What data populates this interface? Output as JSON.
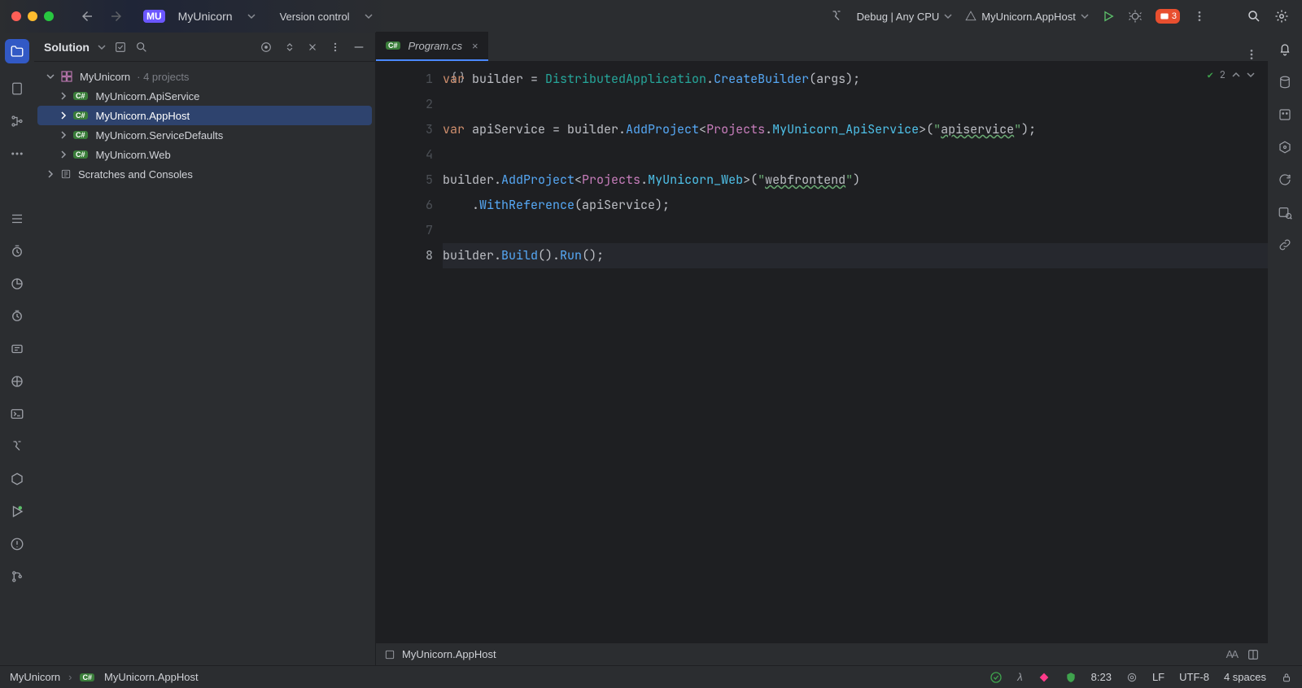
{
  "titlebar": {
    "project_badge": "MU",
    "project_name": "MyUnicorn",
    "version_control": "Version control",
    "run_config": "Debug | Any CPU",
    "target_project": "MyUnicorn.AppHost",
    "notification_count": "3"
  },
  "solution": {
    "title": "Solution",
    "root_name": "MyUnicorn",
    "project_count_label": "· 4 projects",
    "projects": [
      {
        "name": "MyUnicorn.ApiService",
        "selected": false
      },
      {
        "name": "MyUnicorn.AppHost",
        "selected": true
      },
      {
        "name": "MyUnicorn.ServiceDefaults",
        "selected": false
      },
      {
        "name": "MyUnicorn.Web",
        "selected": false
      }
    ],
    "scratches_label": "Scratches and Consoles"
  },
  "editor": {
    "tab": {
      "badge": "C#",
      "filename": "Program.cs"
    },
    "problems_count": "2",
    "code_lines": [
      [
        {
          "t": "var ",
          "c": "kw"
        },
        {
          "t": "builder = ",
          "c": ""
        },
        {
          "t": "DistributedApplication",
          "c": "typegreen"
        },
        {
          "t": ".",
          "c": ""
        },
        {
          "t": "CreateBuilder",
          "c": "meth"
        },
        {
          "t": "(args);",
          "c": ""
        }
      ],
      [],
      [
        {
          "t": "var ",
          "c": "kw"
        },
        {
          "t": "apiService = builder.",
          "c": ""
        },
        {
          "t": "AddProject",
          "c": "meth"
        },
        {
          "t": "<",
          "c": ""
        },
        {
          "t": "Projects",
          "c": "type"
        },
        {
          "t": ".",
          "c": ""
        },
        {
          "t": "MyUnicorn_ApiService",
          "c": "typeteal"
        },
        {
          "t": ">(",
          "c": ""
        },
        {
          "t": "\"",
          "c": "str"
        },
        {
          "t": "apiservice",
          "c": "str-u"
        },
        {
          "t": "\"",
          "c": "str"
        },
        {
          "t": ");",
          "c": ""
        }
      ],
      [],
      [
        {
          "t": "builder.",
          "c": ""
        },
        {
          "t": "AddProject",
          "c": "meth"
        },
        {
          "t": "<",
          "c": ""
        },
        {
          "t": "Projects",
          "c": "type"
        },
        {
          "t": ".",
          "c": ""
        },
        {
          "t": "MyUnicorn_Web",
          "c": "typeteal"
        },
        {
          "t": ">(",
          "c": ""
        },
        {
          "t": "\"",
          "c": "str"
        },
        {
          "t": "webfrontend",
          "c": "str-u"
        },
        {
          "t": "\"",
          "c": "str"
        },
        {
          "t": ")",
          "c": ""
        }
      ],
      [
        {
          "t": "    .",
          "c": ""
        },
        {
          "t": "WithReference",
          "c": "meth"
        },
        {
          "t": "(apiService);",
          "c": ""
        }
      ],
      [],
      [
        {
          "t": "builder.",
          "c": ""
        },
        {
          "t": "Build",
          "c": "meth"
        },
        {
          "t": "().",
          "c": ""
        },
        {
          "t": "Run",
          "c": "meth"
        },
        {
          "t": "();",
          "c": ""
        }
      ]
    ],
    "bottom_crumb": "MyUnicorn.AppHost"
  },
  "statusbar": {
    "crumb_root": "MyUnicorn",
    "crumb_leaf": "MyUnicorn.AppHost",
    "position": "8:23",
    "line_ending": "LF",
    "encoding": "UTF-8",
    "indent": "4 spaces"
  },
  "icons": {
    "csharp_small": "C#"
  }
}
